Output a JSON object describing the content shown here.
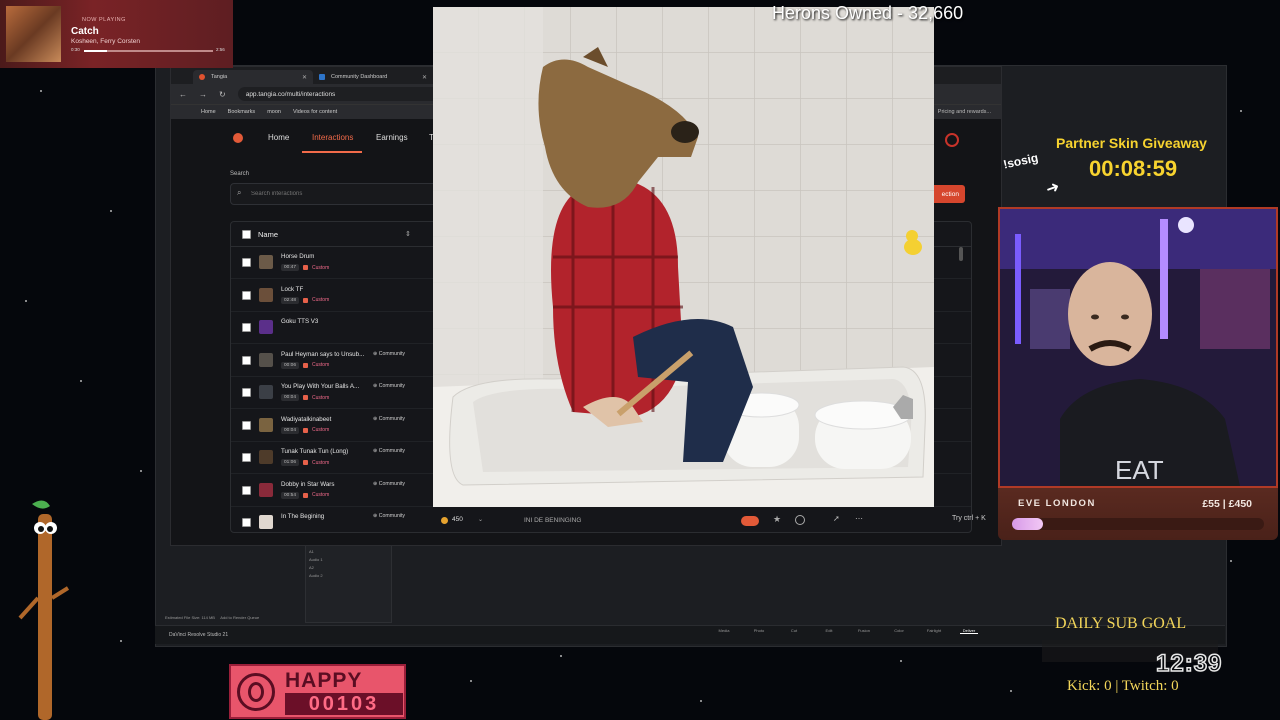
{
  "now_playing": {
    "label": "NOW PLAYING",
    "title": "Catch",
    "artist": "Kosheen, Ferry Corsten",
    "current_time": "0:30",
    "total_time": "2:56",
    "progress": 0.18
  },
  "stream": {
    "herons_counter": "Herons Owned - 32,660",
    "giveaway_title": "Partner Skin Giveaway",
    "giveaway_timer": "00:08:59",
    "sosig_command": "!sosig",
    "goal_name": "EVE LONDON",
    "goal_amount": "£55 | £450",
    "goal_progress": 0.122,
    "daily_sub_goal": "DAILY SUB GOAL",
    "clock": "12:39",
    "kick_twitch": "Kick: 0 | Twitch: 0",
    "sponsor_title": "HAPPY PCs",
    "sponsor_counter": "00103"
  },
  "browser": {
    "tabs": [
      {
        "label": "Tangia",
        "active": true
      },
      {
        "label": "Community Dashboard",
        "active": false
      }
    ],
    "url": "app.tangia.co/multi/interactions",
    "bookmarks": [
      "Home",
      "Bookmarks",
      "moon",
      "Videos for content"
    ],
    "bookmark_right": "Pricing and rewards..."
  },
  "app": {
    "nav": [
      "Home",
      "Interactions",
      "Earnings",
      "T"
    ],
    "search_label": "Search",
    "search_placeholder": "Search interactions",
    "new_button": "ection",
    "table_header": "Name",
    "rows": [
      {
        "name": "Horse Drum",
        "duration": "00:47",
        "custom": "Custom",
        "community": ""
      },
      {
        "name": "Lock TF",
        "duration": "02:48",
        "custom": "Custom",
        "community": ""
      },
      {
        "name": "Goku TTS V3",
        "duration": "",
        "custom": "",
        "community": ""
      },
      {
        "name": "Paul Heyman says to Unsub...",
        "duration": "00:06",
        "custom": "Custom",
        "community": "Community"
      },
      {
        "name": "You Play With Your Balls A...",
        "duration": "00:04",
        "custom": "Custom",
        "community": "Community"
      },
      {
        "name": "Wadiyatalkinabeet",
        "duration": "00:04",
        "custom": "Custom",
        "community": "Community"
      },
      {
        "name": "Tunak Tunak Tun (Long)",
        "duration": "01:06",
        "custom": "Custom",
        "community": "Community"
      },
      {
        "name": "Dobby in Star Wars",
        "duration": "00:54",
        "custom": "Custom",
        "community": "Community"
      },
      {
        "name": "In The Begining",
        "duration": "",
        "custom": "",
        "community": "Community"
      }
    ]
  },
  "player": {
    "cost": "450",
    "title": "INI DE BENINGING",
    "try_hint": "Try ctrl + K"
  },
  "resolve": {
    "app_label": "DaVinci Resolve Studio 21",
    "estimate": "Estimated File Size: 114 MB",
    "add_queue": "Add to Render Queue",
    "pages": [
      "Media",
      "Photo",
      "Cut",
      "Edit",
      "Fusion",
      "Color",
      "Fairlight",
      "Deliver"
    ],
    "active_page": "Deliver",
    "tracks": [
      "A1",
      "Audio 1",
      "A2",
      "Audio 2"
    ]
  }
}
